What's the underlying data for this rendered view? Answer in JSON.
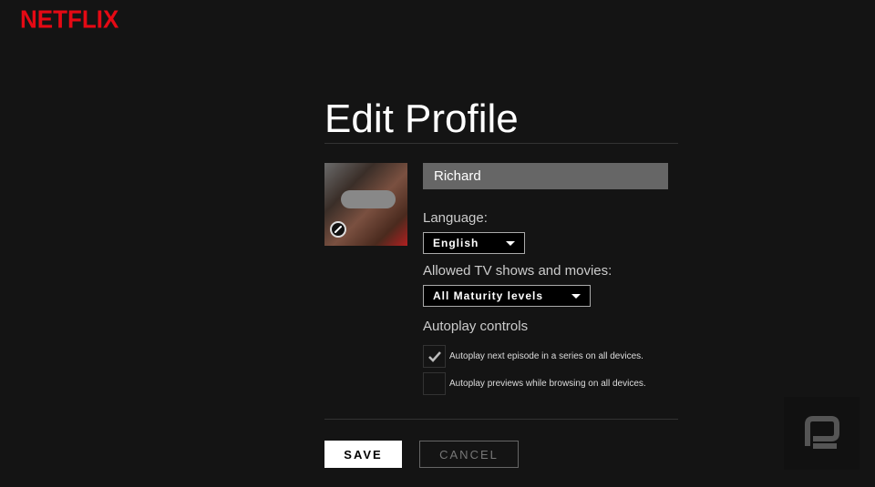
{
  "brand": {
    "logo": "NETFLIX",
    "color": "#e50914"
  },
  "page": {
    "title": "Edit Profile"
  },
  "profile": {
    "name": "Richard",
    "avatar_icon": "pencil-icon"
  },
  "language": {
    "label": "Language:",
    "selected": "English"
  },
  "maturity": {
    "label": "Allowed TV shows and movies:",
    "selected": "All Maturity levels"
  },
  "autoplay": {
    "heading": "Autoplay controls",
    "options": [
      {
        "label": "Autoplay next episode in a series on all devices.",
        "checked": true
      },
      {
        "label": "Autoplay previews while browsing on all devices.",
        "checked": false
      }
    ]
  },
  "actions": {
    "save": "SAVE",
    "cancel": "CANCEL"
  },
  "watermark": {
    "icon": "engadget-logo"
  }
}
